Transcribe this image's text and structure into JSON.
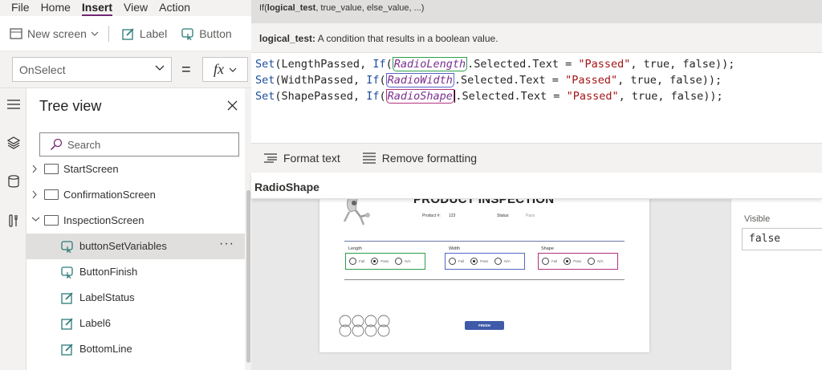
{
  "menu": [
    "File",
    "Home",
    "Insert",
    "View",
    "Action"
  ],
  "ribbon": {
    "new_screen": "New screen",
    "label": "Label",
    "button": "Button"
  },
  "formula_bar": {
    "property": "OnSelect",
    "equals": "=",
    "fx": "fx"
  },
  "tooltip": {
    "signature_prefix": "If(",
    "signature_param": "logical_test",
    "signature_rest": ", true_value, else_value, ...)",
    "param_name": "logical_test:",
    "param_desc": " A condition that results in a boolean value."
  },
  "code": {
    "lines": [
      {
        "var": "LengthPassed",
        "ref": "RadioLength",
        "tail": ".Selected.Text = ",
        "str": "\"Passed\"",
        "end": ", true, false));"
      },
      {
        "var": "WidthPassed",
        "ref": "RadioWidth",
        "tail": ".Selected.Text = ",
        "str": "\"Passed\"",
        "end": ", true, false));"
      },
      {
        "var": "ShapePassed",
        "ref": "RadioShape",
        "tail": ".Selected.Text = ",
        "str": "\"Passed\"",
        "end": ", true, false));"
      }
    ],
    "set_kw": "Set",
    "if_kw": "If"
  },
  "format_bar": {
    "format_text": "Format text",
    "remove_formatting": "Remove formatting"
  },
  "selected_control": "RadioShape",
  "tree": {
    "title": "Tree view",
    "search_placeholder": "Search",
    "items": [
      {
        "label": "StartScreen",
        "kind": "screen"
      },
      {
        "label": "ConfirmationScreen",
        "kind": "screen"
      },
      {
        "label": "InspectionScreen",
        "kind": "screen"
      },
      {
        "label": "buttonSetVariables",
        "kind": "button"
      },
      {
        "label": "ButtonFinish",
        "kind": "button"
      },
      {
        "label": "LabelStatus",
        "kind": "label"
      },
      {
        "label": "Label6",
        "kind": "label"
      },
      {
        "label": "BottomLine",
        "kind": "label"
      }
    ],
    "more": "···"
  },
  "app_preview": {
    "title": "PRODUCT INSPECTION",
    "product_label": "Product #:",
    "product_value": "123",
    "status_label": "Status:",
    "status_value": "Pass",
    "groups": [
      {
        "label": "Length",
        "color": "#2e9e4a"
      },
      {
        "label": "Width",
        "color": "#5566c8"
      },
      {
        "label": "Shape",
        "color": "#b3327f"
      }
    ],
    "options": [
      "Fail",
      "Pass",
      "N/A"
    ],
    "finish": "FINISH"
  },
  "properties": {
    "visible_label": "Visible",
    "visible_value": "false"
  },
  "colors": {
    "accent": "#742774",
    "green": "#2e9e4a",
    "blue": "#5566c8",
    "purple": "#b3327f"
  }
}
